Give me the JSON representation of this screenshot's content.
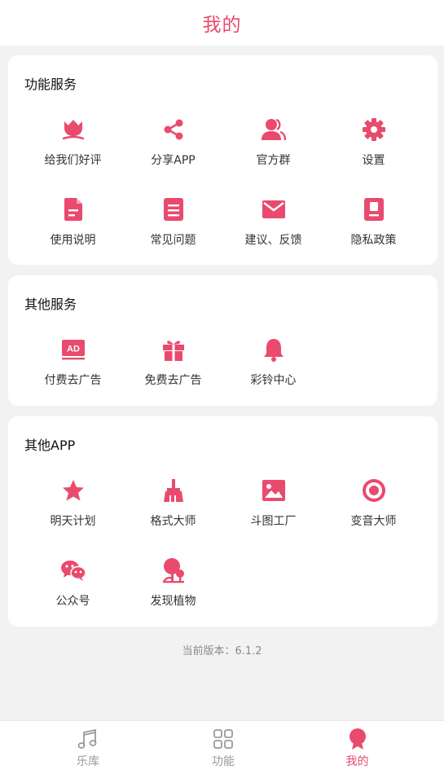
{
  "header": {
    "title": "我的"
  },
  "sections": {
    "functions": {
      "title": "功能服务",
      "items": [
        {
          "label": "给我们好评",
          "icon": "flower-icon"
        },
        {
          "label": "分享APP",
          "icon": "share-icon"
        },
        {
          "label": "官方群",
          "icon": "group-icon"
        },
        {
          "label": "设置",
          "icon": "gear-icon"
        },
        {
          "label": "使用说明",
          "icon": "document-icon"
        },
        {
          "label": "常见问题",
          "icon": "list-icon"
        },
        {
          "label": "建议、反馈",
          "icon": "mail-icon"
        },
        {
          "label": "隐私政策",
          "icon": "privacy-icon"
        }
      ]
    },
    "other_services": {
      "title": "其他服务",
      "items": [
        {
          "label": "付费去广告",
          "icon": "ad-icon",
          "icon_text": "AD"
        },
        {
          "label": "免费去广告",
          "icon": "gift-icon"
        },
        {
          "label": "彩铃中心",
          "icon": "bell-icon"
        }
      ]
    },
    "other_apps": {
      "title": "其他APP",
      "items": [
        {
          "label": "明天计划",
          "icon": "star-icon"
        },
        {
          "label": "格式大师",
          "icon": "broom-icon"
        },
        {
          "label": "斗图工厂",
          "icon": "image-icon"
        },
        {
          "label": "变音大师",
          "icon": "target-icon"
        },
        {
          "label": "公众号",
          "icon": "wechat-icon"
        },
        {
          "label": "发现植物",
          "icon": "plant-icon"
        }
      ]
    }
  },
  "version": {
    "text": "当前版本：6.1.2"
  },
  "tabbar": {
    "tabs": [
      {
        "label": "乐库",
        "icon": "music-note-icon",
        "active": false
      },
      {
        "label": "功能",
        "icon": "grid-icon",
        "active": false
      },
      {
        "label": "我的",
        "icon": "profile-badge-icon",
        "active": true
      }
    ]
  },
  "colors": {
    "accent": "#e94a6e",
    "background": "#f2f2f2",
    "tab_inactive": "#9a9a9a"
  }
}
